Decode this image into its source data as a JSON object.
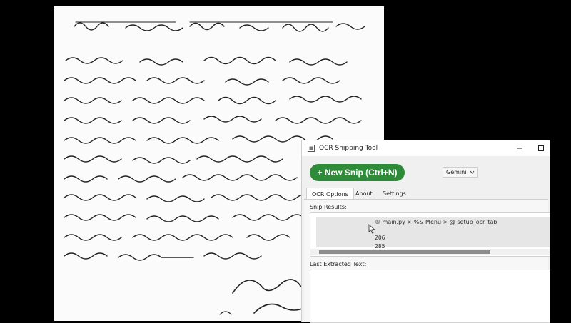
{
  "window": {
    "title": "OCR Snipping Tool",
    "minimize_icon": "minimize-icon",
    "maximize_icon": "maximize-icon"
  },
  "toolbar": {
    "new_snip_label": "+ New Snip (Ctrl+N)",
    "model_selected": "Gemini"
  },
  "tabs": [
    {
      "label": "OCR Options",
      "active": true
    },
    {
      "label": "About",
      "active": false
    },
    {
      "label": "Settings",
      "active": false
    }
  ],
  "snip_results": {
    "label": "Snip Results:",
    "breadcrumb": "® main.py > %& Menu > @ setup_ocr_tab",
    "lines": [
      "206",
      "285"
    ]
  },
  "last_extracted": {
    "label": "Last Extracted Text:",
    "value": ""
  },
  "colors": {
    "accent_green": "#2e8b3a",
    "background": "#000000"
  }
}
